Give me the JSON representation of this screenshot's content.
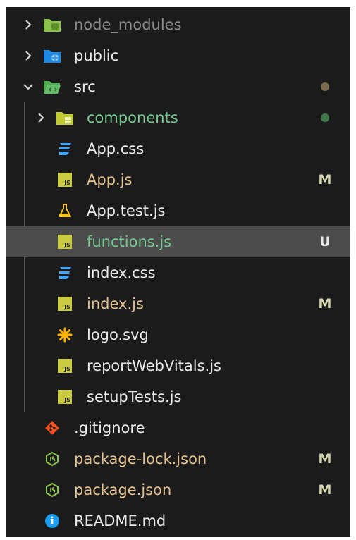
{
  "explorer": {
    "items": [
      {
        "label": "node_modules",
        "status": ""
      },
      {
        "label": "public",
        "status": ""
      },
      {
        "label": "src",
        "status": ""
      },
      {
        "label": "components",
        "status": ""
      },
      {
        "label": "App.css",
        "status": ""
      },
      {
        "label": "App.js",
        "status": "M"
      },
      {
        "label": "App.test.js",
        "status": ""
      },
      {
        "label": "functions.js",
        "status": "U"
      },
      {
        "label": "index.css",
        "status": ""
      },
      {
        "label": "index.js",
        "status": "M"
      },
      {
        "label": "logo.svg",
        "status": ""
      },
      {
        "label": "reportWebVitals.js",
        "status": ""
      },
      {
        "label": "setupTests.js",
        "status": ""
      },
      {
        "label": ".gitignore",
        "status": ""
      },
      {
        "label": "package-lock.json",
        "status": "M"
      },
      {
        "label": "package.json",
        "status": "M"
      },
      {
        "label": "README.md",
        "status": ""
      }
    ],
    "js_badge": "JS",
    "info_glyph": "i"
  },
  "colors": {
    "background": "#1b1b1b",
    "selected_row": "#4b4b4b",
    "modified_text": "#e2c08d",
    "untracked_text": "#74c991",
    "ignored_text": "#8b8b8b",
    "js_icon": "#cbcb41",
    "css_icon": "#42a5f5",
    "node_icon": "#8bc34a"
  }
}
